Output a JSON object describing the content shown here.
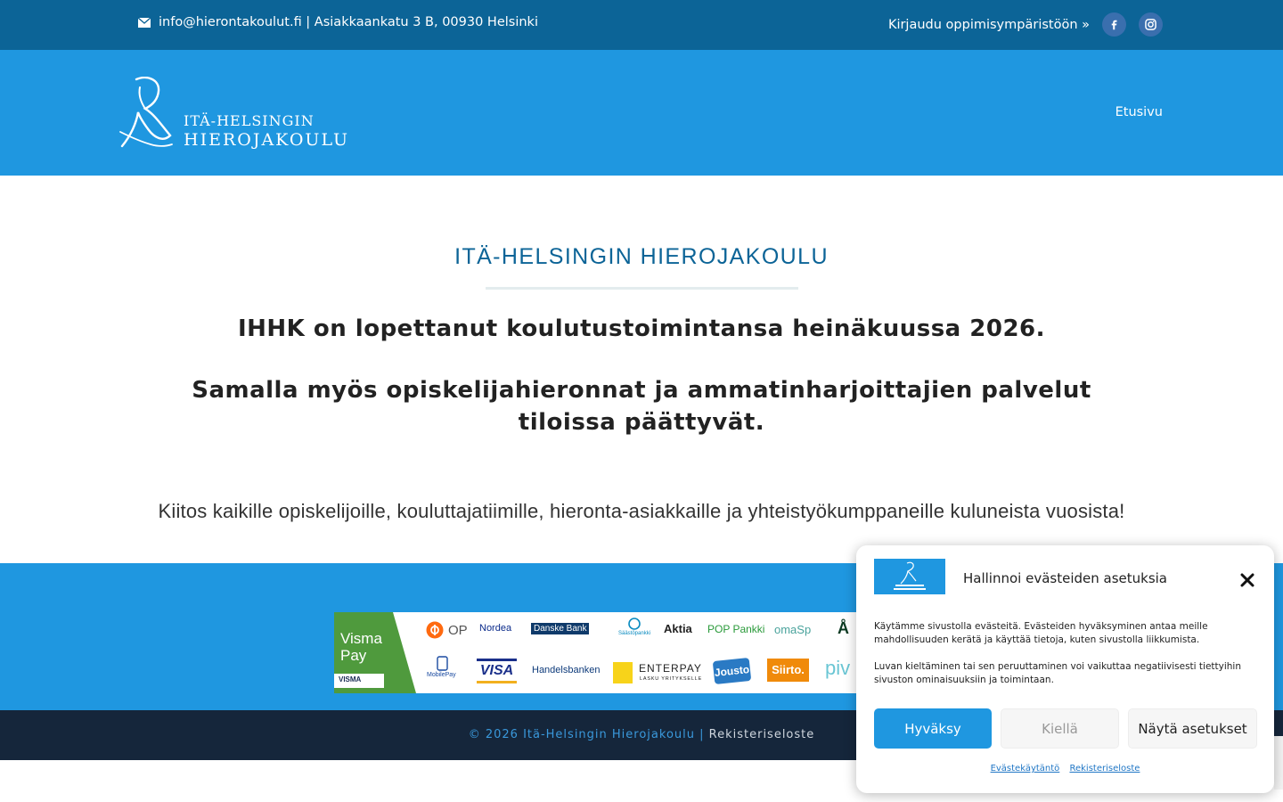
{
  "topbar": {
    "contact": "info@hierontakoulut.fi | Asiakkaankatu 3 B, 00930 Helsinki",
    "login_link": "Kirjaudu oppimisympäristöön »",
    "social": [
      {
        "icon": "facebook-icon"
      },
      {
        "icon": "instagram-icon"
      }
    ]
  },
  "header": {
    "logo_line1": "ITÄ-HELSINGIN",
    "logo_line2": "HIEROJAKOULU",
    "nav": [
      "Etusivu"
    ]
  },
  "main": {
    "school_title": "ITÄ-HELSINGIN HIEROJAKOULU",
    "headline1": "IHHK on lopettanut koulutustoimintansa heinäkuussa 2026.",
    "headline2": "Samalla myös opiskelijahieronnat ja ammatinharjoittajien palvelut tiloissa päättyvät.",
    "thanks": "Kiitos kaikille opiskelijoille, kouluttajatiimille, hieronta-asiakkaille ja yhteistyökumppaneille kuluneista vuosista!"
  },
  "payments": {
    "provider": "Visma Pay",
    "provider_tag": "VISMA",
    "row1": [
      "OP",
      "Nordea",
      "Danske Bank",
      "Säästöpankki",
      "Aktia",
      "POP Pankki",
      "omaSp"
    ],
    "row2": [
      "MobilePay",
      "VISA",
      "Handelsbanken",
      "ENTERPAY",
      "LASKU YRITYKSELLE",
      "Jousto",
      "Siirto.",
      "piv"
    ]
  },
  "footer": {
    "copyright": "© 2026 Itä-Helsingin Hierojakoulu |",
    "register_link": "Rekisteriseloste"
  },
  "cookie_banner": {
    "title": "Hallinnoi evästeiden asetuksia",
    "text1": "Käytämme sivustolla evästeitä. Evästeiden hyväksyminen antaa meille mahdollisuuden kerätä ja käyttää tietoja, kuten sivustolla liikkumista.",
    "text2": "Luvan kieltäminen tai sen peruuttaminen voi vaikuttaa negatiivisesti tiettyihin sivuston ominaisuuksiin ja toimintaan.",
    "accept_label": "Hyväksy",
    "deny_label": "Kiellä",
    "show_label": "Näytä asetukset",
    "link_policy": "Evästekäytäntö",
    "link_register": "Rekisteriseloste"
  },
  "colors": {
    "topbar": "#0c6497",
    "header": "#1f97e0",
    "footer": "#15263b",
    "accent": "#1f97e0",
    "title": "#0c6497"
  }
}
